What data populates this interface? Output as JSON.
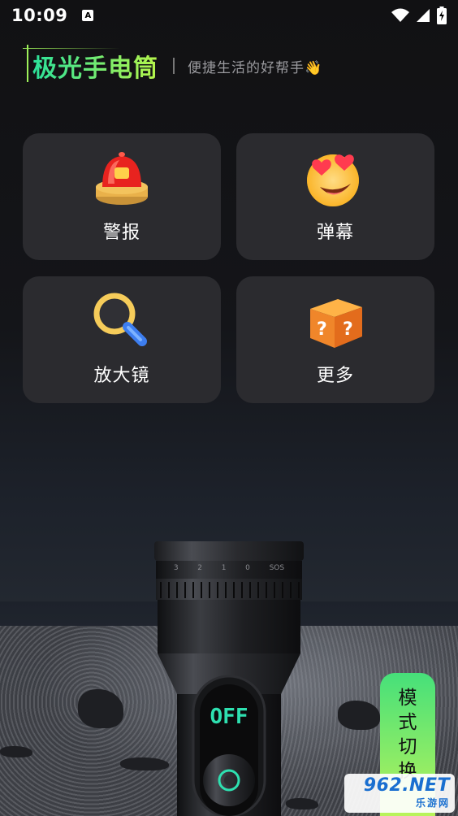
{
  "status_bar": {
    "time": "10:09",
    "notification_icon": "a-letter-icon",
    "icons": [
      "wifi-icon",
      "signal-icon",
      "battery-charging-icon"
    ]
  },
  "header": {
    "app_title": "极光手电筒",
    "slogan": "便捷生活的好帮手👋"
  },
  "cards": [
    {
      "label": "警报",
      "icon": "siren-icon"
    },
    {
      "label": "弹幕",
      "icon": "heart-eyes-emoji-icon"
    },
    {
      "label": "放大镜",
      "icon": "magnifier-icon"
    },
    {
      "label": "更多",
      "icon": "mystery-box-icon"
    }
  ],
  "flashlight": {
    "dial_marks": [
      "3",
      "2",
      "1",
      "0",
      "SOS"
    ],
    "switch_state": "OFF"
  },
  "mode_button": {
    "chars": [
      "模",
      "式",
      "切",
      "换"
    ]
  },
  "watermark": {
    "main": "962.NET",
    "sub": "乐游网"
  },
  "colors": {
    "accent_gradient_start": "#22e0a0",
    "accent_gradient_end": "#b9f35a",
    "card_bg": "#2b2b2f",
    "switch_text": "#2ee0b0"
  }
}
